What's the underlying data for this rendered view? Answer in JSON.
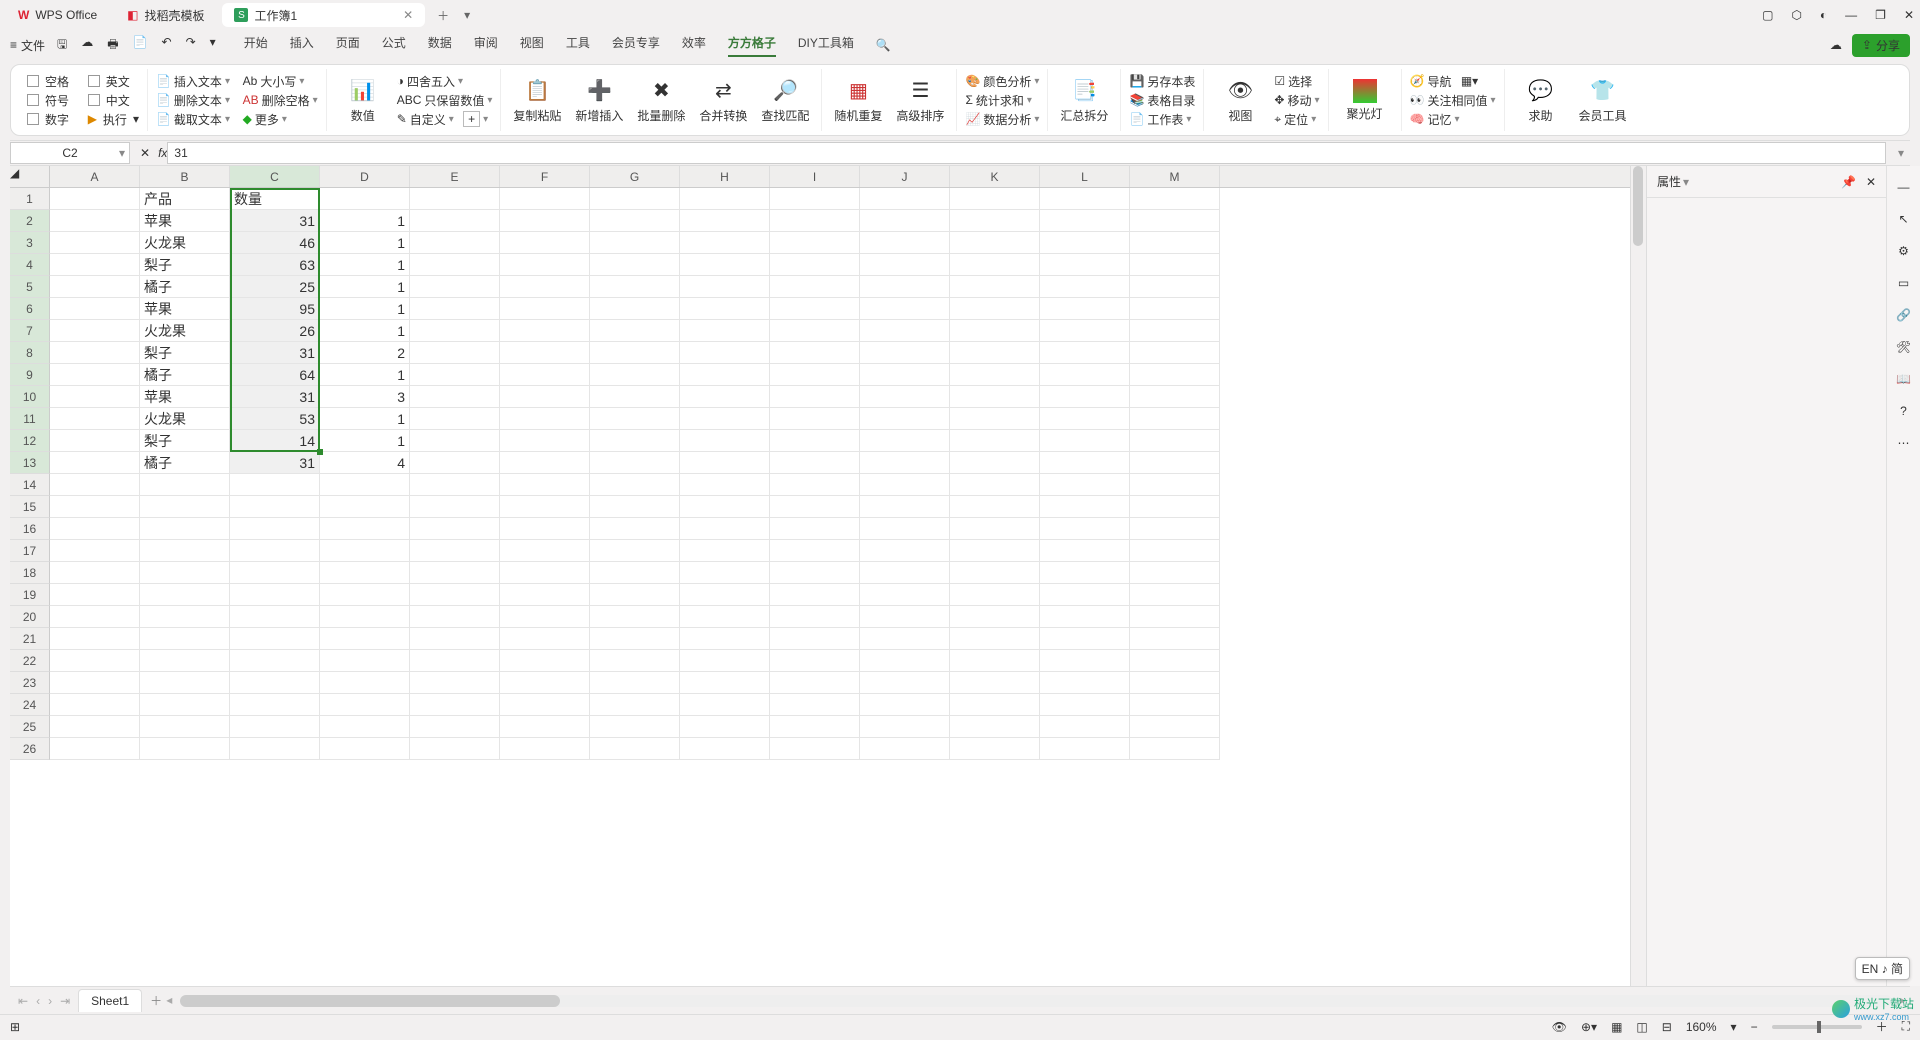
{
  "title_tabs": {
    "app": "WPS Office",
    "template": "找稻壳模板",
    "workbook": "工作簿1"
  },
  "menu": {
    "file": "文件",
    "tabs": [
      "开始",
      "插入",
      "页面",
      "公式",
      "数据",
      "审阅",
      "视图",
      "工具",
      "会员专享",
      "效率",
      "方方格子",
      "DIY工具箱"
    ],
    "active_index": 10,
    "share": "分享"
  },
  "ribbon": {
    "g1": {
      "space": "空格",
      "en": "英文",
      "sym": "符号",
      "cn": "中文",
      "num": "数字",
      "exec": "执行"
    },
    "g2": {
      "insert": "插入文本",
      "case": "大小写",
      "delete": "删除文本",
      "delspace": "删除空格",
      "extract": "截取文本",
      "more": "更多"
    },
    "g3": {
      "value": "数值",
      "round": "四舍五入",
      "keepnum": "只保留数值",
      "custom": "自定义",
      "plus": "+"
    },
    "g4": {
      "copy": "复制粘贴",
      "newins": "新增插入",
      "batchdel": "批量删除",
      "merge": "合并转换",
      "find": "查找匹配"
    },
    "g5": {
      "rand": "随机重复",
      "sort": "高级排序"
    },
    "g6": {
      "color": "颜色分析",
      "stat": "统计求和",
      "data": "数据分析"
    },
    "g7": {
      "split": "汇总拆分"
    },
    "g8": {
      "saveas": "另存本表",
      "toc": "表格目录",
      "ws": "工作表"
    },
    "g9": {
      "view": "视图",
      "select": "选择",
      "move": "移动",
      "locate": "定位"
    },
    "g10": {
      "spot": "聚光灯"
    },
    "g11": {
      "nav": "导航",
      "watch": "关注相同值",
      "mem": "记忆"
    },
    "g12": {
      "help": "求助",
      "member": "会员工具"
    }
  },
  "formula": {
    "cellref": "C2",
    "fx": "fx",
    "value": "31"
  },
  "columns": [
    "A",
    "B",
    "C",
    "D",
    "E",
    "F",
    "G",
    "H",
    "I",
    "J",
    "K",
    "L",
    "M"
  ],
  "row_count": 26,
  "headers": {
    "b": "产品",
    "c": "数量"
  },
  "data_rows": [
    {
      "b": "苹果",
      "c": 31,
      "d": 1
    },
    {
      "b": "火龙果",
      "c": 46,
      "d": 1
    },
    {
      "b": "梨子",
      "c": 63,
      "d": 1
    },
    {
      "b": "橘子",
      "c": 25,
      "d": 1
    },
    {
      "b": "苹果",
      "c": 95,
      "d": 1
    },
    {
      "b": "火龙果",
      "c": 26,
      "d": 1
    },
    {
      "b": "梨子",
      "c": 31,
      "d": 2
    },
    {
      "b": "橘子",
      "c": 64,
      "d": 1
    },
    {
      "b": "苹果",
      "c": 31,
      "d": 3
    },
    {
      "b": "火龙果",
      "c": 53,
      "d": 1
    },
    {
      "b": "梨子",
      "c": 14,
      "d": 1
    },
    {
      "b": "橘子",
      "c": 31,
      "d": 4
    }
  ],
  "panel": {
    "title": "属性"
  },
  "sheet_tab": "Sheet1",
  "status": {
    "zoom": "160%"
  },
  "ime": "EN ♪ 简",
  "watermark": {
    "name": "极光下载站",
    "url": "www.xz7.com"
  }
}
